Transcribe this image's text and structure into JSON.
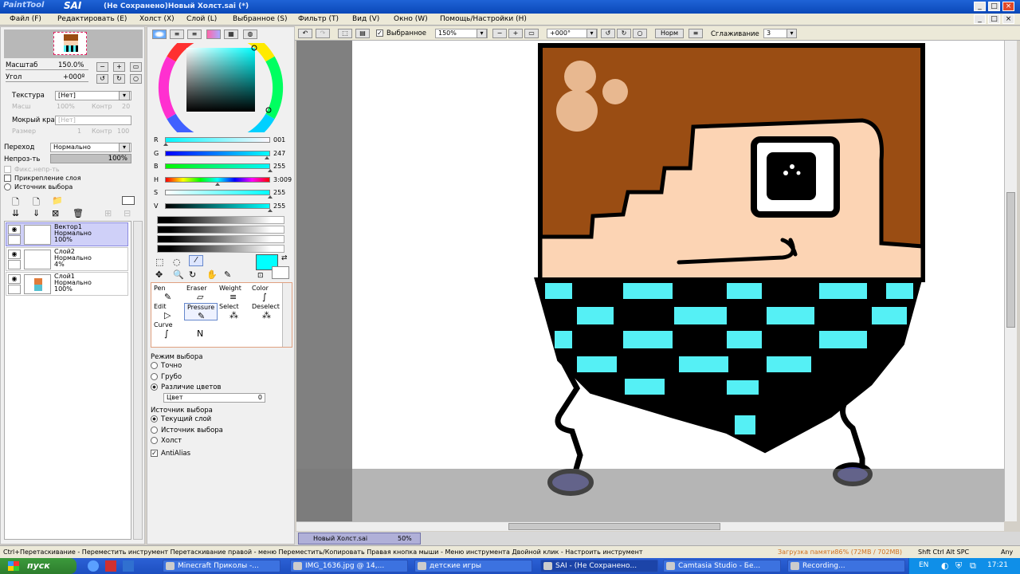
{
  "titlebar": {
    "logo_small": "PaintTool",
    "logo_big": "SAI",
    "title": "(Не Сохранено)Новый Холст.sai (*)"
  },
  "menu": [
    "Файл (F)",
    "Редактировать (E)",
    "Холст (X)",
    "Слой (L)",
    "Выбранное (S)",
    "Фильтр (T)",
    "Вид (V)",
    "Окно (W)",
    "Помощь/Настройки (H)"
  ],
  "nav": {
    "scale_label": "Масштаб",
    "scale_value": "150.0%",
    "angle_label": "Угол",
    "angle_value": "+000º"
  },
  "texture": {
    "texture_label": "Текстура",
    "texture_value": "[Нет]",
    "scale_label": "Масш",
    "scale_value": "100%",
    "contrast_label": "Контр",
    "contrast_value": "20",
    "wet_label": "Мокрый край",
    "wet_value": "[Нет]",
    "size_label": "Размер",
    "size_value": "1",
    "contrast2_label": "Контр",
    "contrast2_value": "100"
  },
  "blend": {
    "mode_label": "Переход",
    "mode_value": "Нормально",
    "opacity_label": "Непроз-ть",
    "opacity_value": "100%",
    "opacity_fraction": 1.0
  },
  "layer_checks": {
    "protect": "Фикс.непр-ть",
    "clip": "Прикрепление слоя",
    "source": "Источник выбора"
  },
  "layers": [
    {
      "name": "Вектор1",
      "mode": "Нормально",
      "opacity": "100%",
      "selected": true
    },
    {
      "name": "Слой2",
      "mode": "Нормально",
      "opacity": "4%",
      "selected": false
    },
    {
      "name": "Слой1",
      "mode": "Нормально",
      "opacity": "100%",
      "selected": false
    }
  ],
  "color": {
    "current": "#00ffff",
    "sliders": [
      {
        "label": "R",
        "value": "001",
        "fraction": 0.004
      },
      {
        "label": "G",
        "value": "247",
        "fraction": 0.97
      },
      {
        "label": "B",
        "value": "255",
        "fraction": 1.0
      },
      {
        "label": "H",
        "value": "3:009",
        "fraction": 0.5
      },
      {
        "label": "S",
        "value": "255",
        "fraction": 1.0
      },
      {
        "label": "V",
        "value": "255",
        "fraction": 1.0
      }
    ]
  },
  "tools": [
    {
      "label": "Pen",
      "icon": "pen-icon"
    },
    {
      "label": "Eraser",
      "icon": "eraser-icon"
    },
    {
      "label": "Weight",
      "icon": "weight-icon"
    },
    {
      "label": "Color",
      "icon": "color-icon"
    },
    {
      "label": "Edit",
      "icon": "edit-icon"
    },
    {
      "label": "Pressure",
      "icon": "pressure-icon"
    },
    {
      "label": "Select",
      "icon": "select-icon"
    },
    {
      "label": "Deselect",
      "icon": "deselect-icon"
    },
    {
      "label": "Curve",
      "icon": "curve-icon"
    },
    {
      "label": "",
      "icon": "node-icon"
    }
  ],
  "select_options": {
    "mode_title": "Режим выбора",
    "mode_options": [
      {
        "label": "Точно",
        "on": false
      },
      {
        "label": "Грубо",
        "on": false
      },
      {
        "label": "Различие цветов",
        "on": true
      }
    ],
    "color_dropdown": "Цвет",
    "color_dropdown_value": "0",
    "source_title": "Источник выбора",
    "source_options": [
      {
        "label": "Текущий слой",
        "on": true
      },
      {
        "label": "Источник выбора",
        "on": false
      },
      {
        "label": "Холст",
        "on": false
      }
    ],
    "antialias": "AntiAlias"
  },
  "toolbar": {
    "selection_check": "Выбранное",
    "zoom": "150%",
    "angle": "+000°",
    "mode": "Норм",
    "smoothing_label": "Сглаживание",
    "smoothing_value": "3"
  },
  "canvas_tab": {
    "name": "Новый Холст.sai",
    "zoom": "50%"
  },
  "status": {
    "hint": "Ctrl+Перетаскивание - Переместить инструмент   Перетаскивание правой - меню Переместить/Копировать   Правая кнопка мыши - Меню инструмента   Двойной клик - Настроить инструмент",
    "memory": "Загрузка памяти86% (72MB / 702MB)",
    "keys": "Shft Ctrl Alt SPC",
    "any": "Any"
  },
  "taskbar": {
    "start": "пуск",
    "items": [
      {
        "label": "Minecraft Приколы -...",
        "active": false
      },
      {
        "label": "IMG_1636.jpg @ 14,...",
        "active": false
      },
      {
        "label": "детские игры",
        "active": false
      },
      {
        "label": "SAI - (Не Сохранено...",
        "active": true
      },
      {
        "label": "Camtasia Studio - Бе...",
        "active": false
      },
      {
        "label": "Recording...",
        "active": false
      }
    ],
    "lang": "EN",
    "time": "17:21"
  },
  "colors": {
    "title_blue": "#0a48b8",
    "panel_bg": "#f0f0f0",
    "canvas_bg": "#808080",
    "brown_hair": "#9a4d13",
    "skin": "#fcd4b4",
    "cyan": "#55f0f5"
  }
}
